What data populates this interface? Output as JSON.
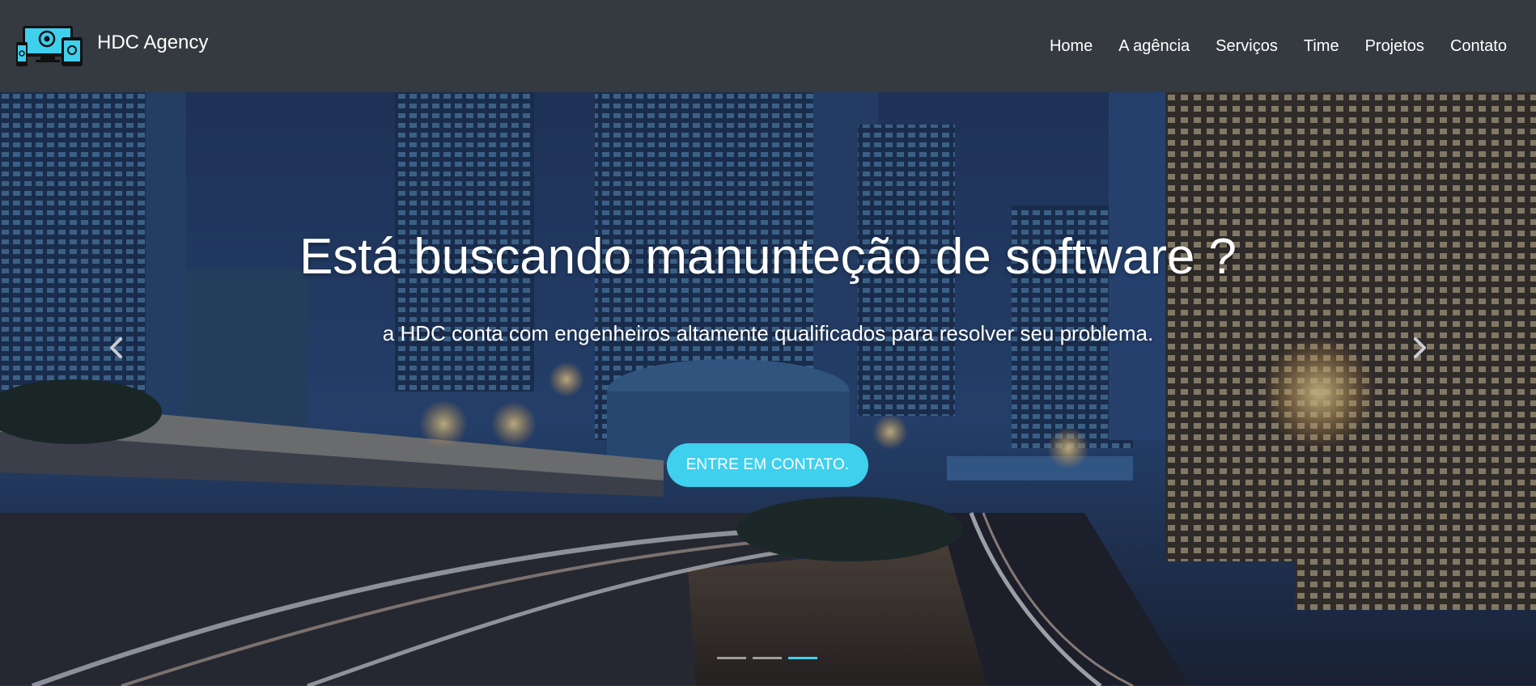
{
  "brand": {
    "name": "HDC Agency",
    "logo_icon": "devices-logo-icon"
  },
  "nav": {
    "items": [
      {
        "label": "Home"
      },
      {
        "label": "A agência"
      },
      {
        "label": "Serviços"
      },
      {
        "label": "Time"
      },
      {
        "label": "Projetos"
      },
      {
        "label": "Contato"
      }
    ]
  },
  "hero": {
    "headline": "Está buscando manunteção de software ?",
    "subline": "a HDC conta com engenheiros altamente qualificados para resolver seu problema.",
    "cta_label": "ENTRE EM CONTATO.",
    "prev_icon": "chevron-left-icon",
    "next_icon": "chevron-right-icon",
    "slides_count": 3,
    "active_slide": 3,
    "background": "night-city-skyline-image"
  },
  "colors": {
    "navbar_bg": "#343a3f",
    "accent": "#3fd0ee",
    "text": "#ffffff"
  }
}
